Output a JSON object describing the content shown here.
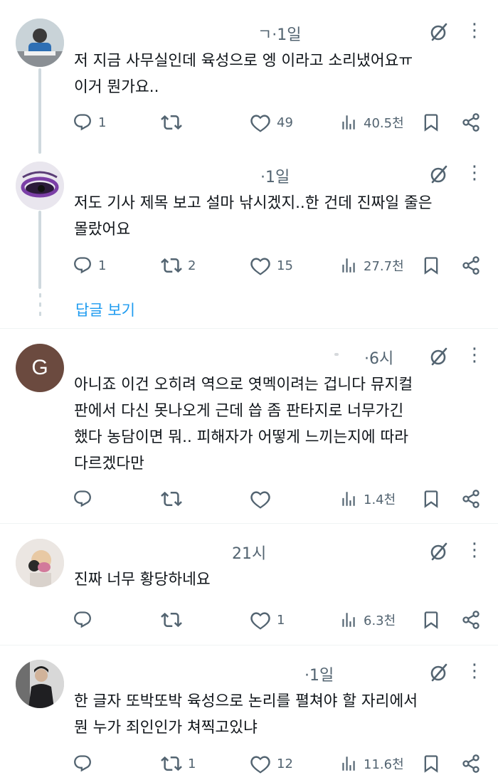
{
  "tweets": [
    {
      "time": "ㄱ·1일",
      "text": "저 지금 사무실인데 육성으로 엥 이라고 소리냈어요ㅠ\n이거 뭔가요..",
      "replies": "1",
      "retweets": "",
      "likes": "49",
      "views": "40.5천"
    },
    {
      "time": "·1일",
      "text": "저도 기사 제목 보고 설마 낚시겠지..한 건데 진짜일 줄은\n몰랐어요",
      "replies": "1",
      "retweets": "2",
      "likes": "15",
      "views": "27.7천"
    },
    {
      "time": "·6시",
      "avatar_letter": "G",
      "text": "아니죠 이건 오히려 역으로 엿멕이려는 겁니다 뮤지컬\n판에서 다신 못나오게 근데 씁 좀 판타지로 너무가긴\n했다 농담이면 뭐.. 피해자가 어떻게 느끼는지에 따라\n다르겠다만",
      "replies": "",
      "retweets": "",
      "likes": "",
      "views": "1.4천"
    },
    {
      "time": "21시",
      "text": "진짜 너무 황당하네요",
      "replies": "",
      "retweets": "",
      "likes": "1",
      "views": "6.3천"
    },
    {
      "time": "·1일",
      "text": "한 글자 또박또박 육성으로 논리를 펼쳐야 할 자리에서\n뭔 누가 죄인인가 쳐찍고있냐",
      "replies": "",
      "retweets": "1",
      "likes": "12",
      "views": "11.6천"
    }
  ],
  "show_replies": "답글 보기",
  "colors": {
    "secondary": "#536471",
    "accent": "#1d9bf0",
    "divider": "#eff3f4",
    "avatar_g": "#6b4a3f"
  },
  "icons": [
    "reply-icon",
    "retweet-icon",
    "like-icon",
    "views-icon",
    "bookmark-icon",
    "share-icon",
    "grok-icon",
    "more-icon"
  ]
}
